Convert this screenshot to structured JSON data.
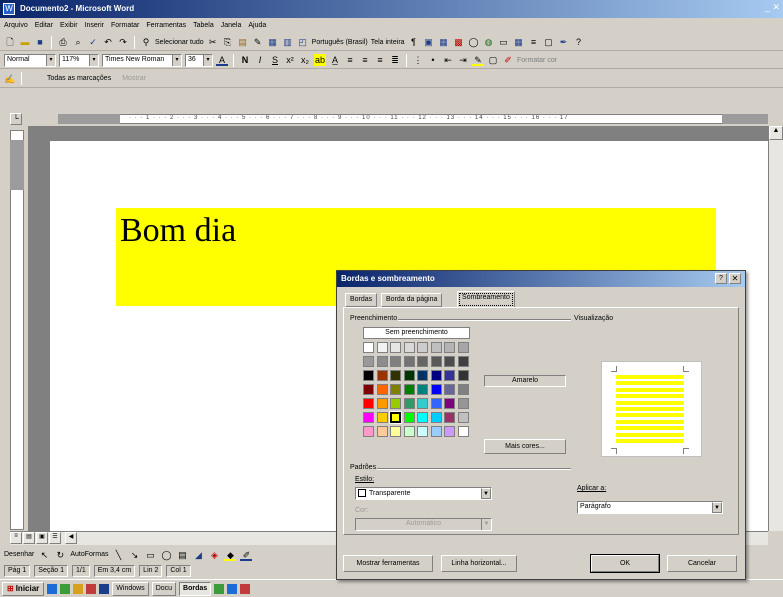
{
  "window": {
    "title": "Documento2 - Microsoft Word",
    "close_label": "_ ✕"
  },
  "menu": [
    "Arquivo",
    "Editar",
    "Exibir",
    "Inserir",
    "Formatar",
    "Ferramentas",
    "Tabela",
    "Janela",
    "Ajuda"
  ],
  "toolbar_standard": {
    "select_all": "Selecionar tudo",
    "language": "Português (Brasil)",
    "mode": "Tela inteira"
  },
  "toolbar_formatting": {
    "style": "Normal",
    "zoom": "117%",
    "font": "Times New Roman",
    "font_size": "36",
    "extra": "Formatar cor"
  },
  "toolbar_review": {
    "markup": "Todas as marcações",
    "show": "Mostrar"
  },
  "ruler_numbers": "· · · 1 · · · 2 · · · 3 · · · 4 · · · 5 · · · 6 · · · 7 · · · 8 · · · 9 · · · 10 · · · 11 · · · 12 · · · 13 · · · 14 · · · 15 · · · 16 · · · 17",
  "document": {
    "text": "Bom dia",
    "highlight_color": "#ffff00"
  },
  "draw_toolbar": {
    "draw_label": "Desenhar",
    "autoshapes_label": "AutoFormas"
  },
  "statusbar": {
    "page": "Pág 1",
    "section": "Seção 1",
    "pages": "1/1",
    "position": "Em 3,4 cm",
    "line": "Lin 2",
    "column": "Col 1"
  },
  "taskbar": {
    "start": "Iniciar",
    "tasks": [
      "Windows",
      "Docu",
      "Bordas"
    ]
  },
  "dialog": {
    "title": "Bordas e sombreamento",
    "help": "?",
    "close": "✕",
    "tabs": [
      "Bordas",
      "Borda da página",
      "Sombreamento"
    ],
    "active_tab": "Sombreamento",
    "fill_group": "Preenchimento",
    "no_fill": "Sem preenchimento",
    "selected_color_name": "Amarelo",
    "more_colors": "Mais cores...",
    "patterns_group": "Padrões",
    "style_label": "Estilo:",
    "style_value": "Transparente",
    "color_label": "Cor:",
    "color_value": "Automático",
    "preview_label": "Visualização",
    "apply_label": "Aplicar a:",
    "apply_value": "Parágrafo",
    "show_toolbar_button": "Mostrar ferramentas",
    "horizontal_line_button": "Linha horizontal...",
    "ok_button": "OK",
    "cancel_button": "Cancelar"
  },
  "palette_colors": [
    [
      "#000000",
      "#993300",
      "#333300",
      "#003300",
      "#003366",
      "#000080",
      "#333399",
      "#333333"
    ],
    [
      "#800000",
      "#ff6600",
      "#808000",
      "#008000",
      "#008080",
      "#0000ff",
      "#666699",
      "#808080"
    ],
    [
      "#ff0000",
      "#ff9900",
      "#99cc00",
      "#339966",
      "#33cccc",
      "#3366ff",
      "#800080",
      "#969696"
    ],
    [
      "#ff00ff",
      "#ffcc00",
      "#ffff00",
      "#00ff00",
      "#00ffff",
      "#00ccff",
      "#993366",
      "#c0c0c0"
    ],
    [
      "#ff99cc",
      "#ffcc99",
      "#ffff99",
      "#ccffcc",
      "#ccffff",
      "#99ccff",
      "#cc99ff",
      "#ffffff"
    ]
  ],
  "palette_grays": [
    [
      "#ffffff",
      "#f2f2f2",
      "#e6e6e6",
      "#d9d9d9",
      "#cccccc",
      "#bfbfbf",
      "#b3b3b3",
      "#a6a6a6"
    ],
    [
      "#999999",
      "#8c8c8c",
      "#808080",
      "#737373",
      "#666666",
      "#595959",
      "#4d4d4d",
      "#404040"
    ]
  ]
}
